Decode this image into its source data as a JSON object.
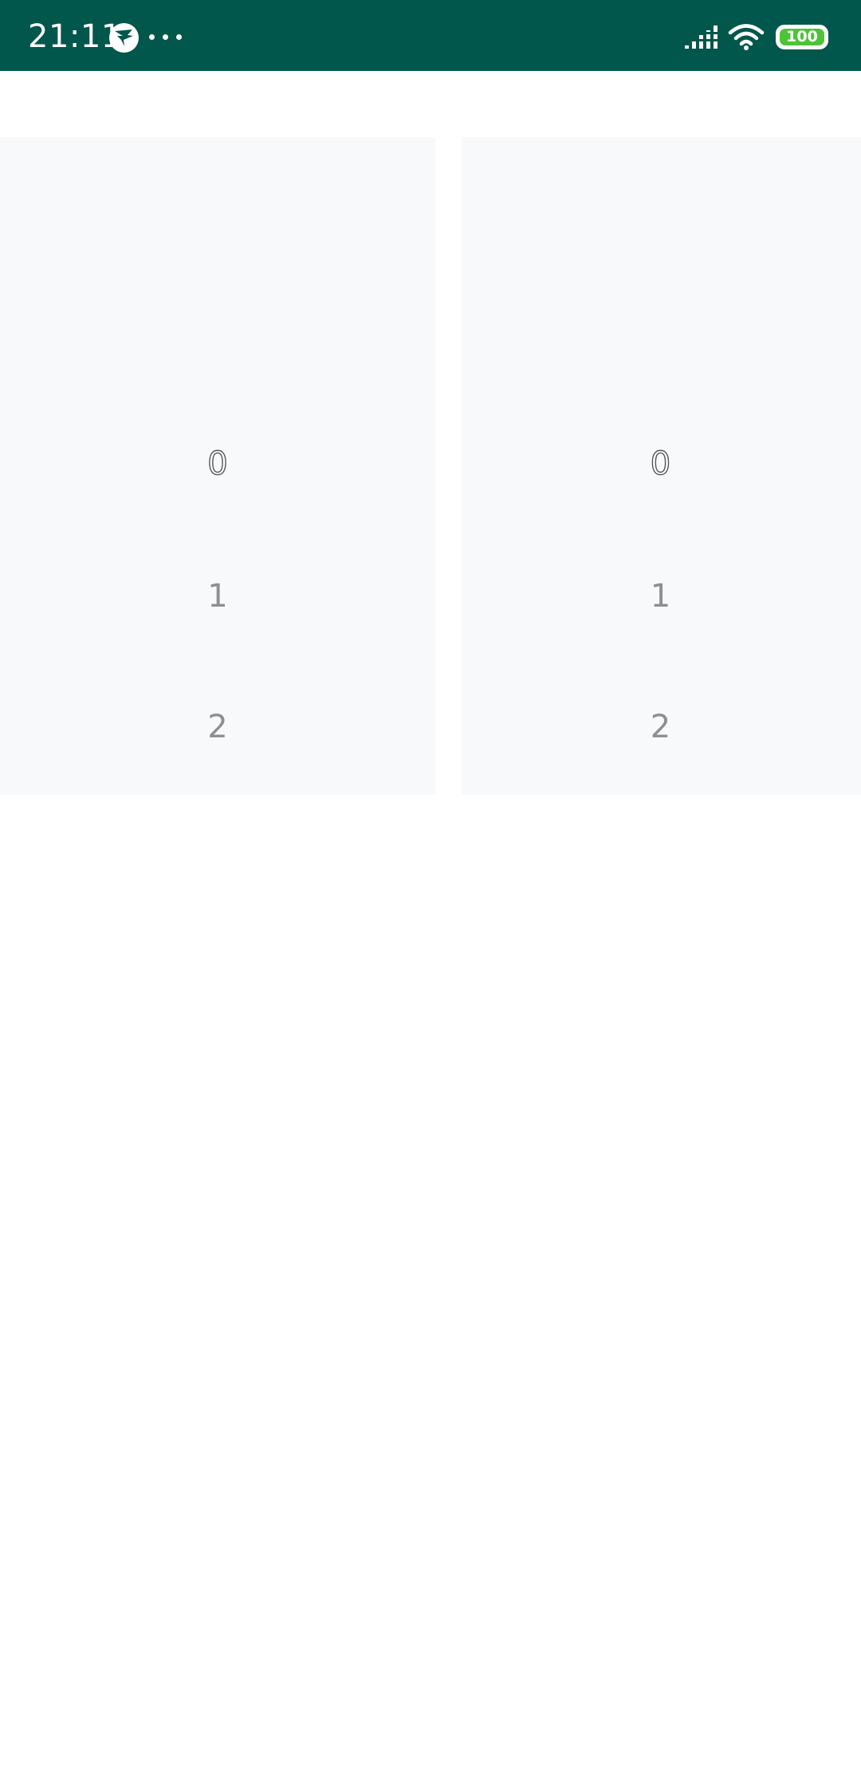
{
  "status_bar": {
    "time": "21:11",
    "app_icon": "bird-icon",
    "more_icon": "more-dots-icon",
    "signal_icon": "signal-icon",
    "wifi_icon": "wifi-icon",
    "battery_level": "100",
    "background_color": "#02574c",
    "battery_color": "#4cc436"
  },
  "pickers": {
    "left": {
      "items": [
        "0",
        "1",
        "2"
      ],
      "selected_value": "0"
    },
    "right": {
      "items": [
        "0",
        "1",
        "2"
      ],
      "selected_value": "0"
    },
    "background_color": "#f8f9fb",
    "item_color": "#8f8f8f"
  }
}
